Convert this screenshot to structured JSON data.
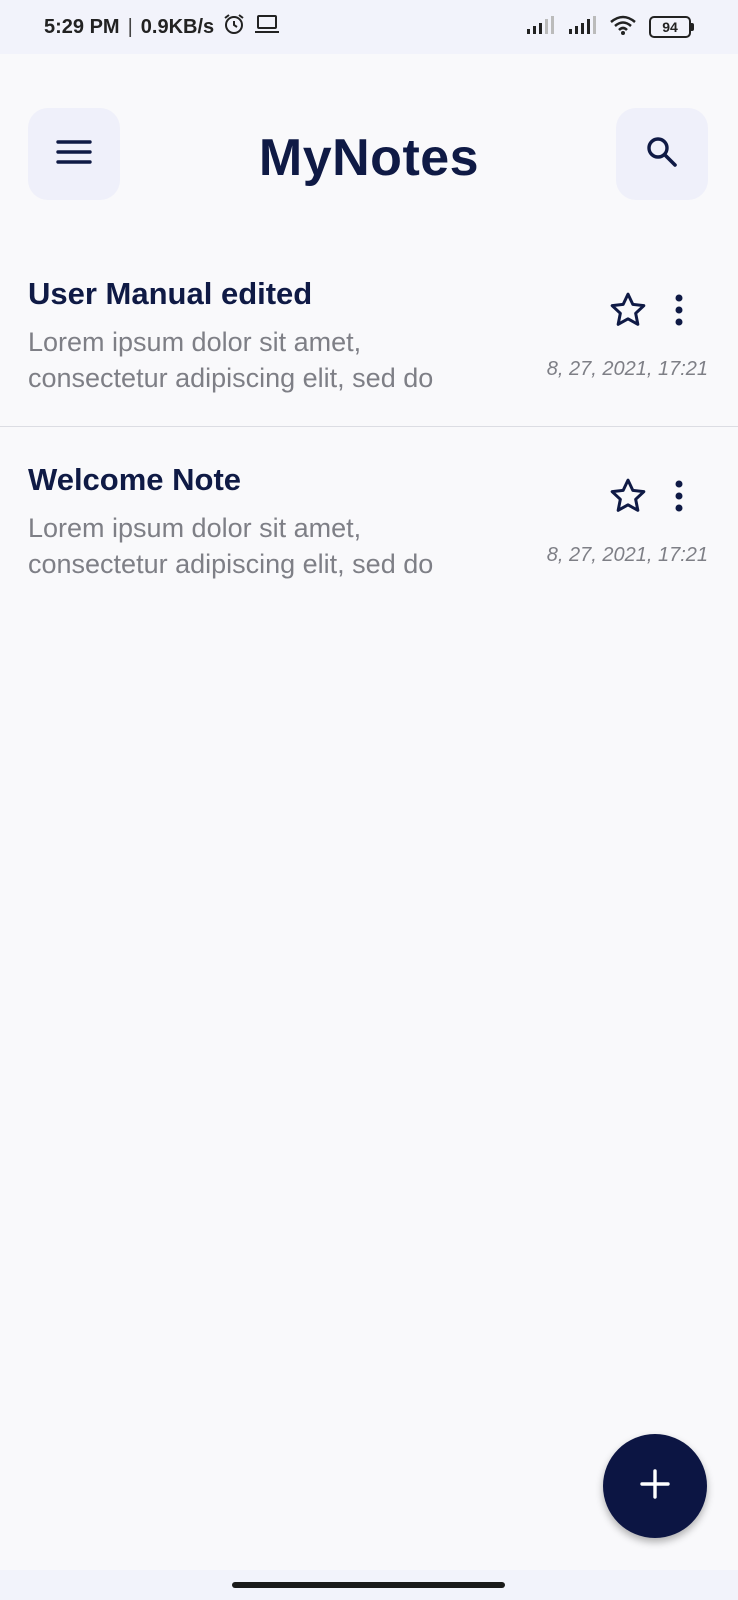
{
  "status_bar": {
    "time": "5:29 PM",
    "separator": "|",
    "net_speed": "0.9KB/s",
    "battery": "94"
  },
  "header": {
    "title": "MyNotes"
  },
  "notes": [
    {
      "title": "User Manual edited",
      "body": "Lorem ipsum dolor sit amet, consectetur adipiscing elit, sed do",
      "date": "8, 27, 2021, 17:21"
    },
    {
      "title": "Welcome Note",
      "body": "Lorem ipsum dolor sit amet, consectetur adipiscing elit, sed do",
      "date": "8, 27, 2021, 17:21"
    }
  ],
  "colors": {
    "primary": "#0f1a45",
    "fab": "#0c1543",
    "icon_button_bg": "#eff0fa",
    "secondary_text": "#7e7f86"
  },
  "icons": {
    "menu": "menu-icon",
    "search": "search-icon",
    "star": "star-outline-icon",
    "more": "more-vertical-icon",
    "add": "plus-icon"
  }
}
